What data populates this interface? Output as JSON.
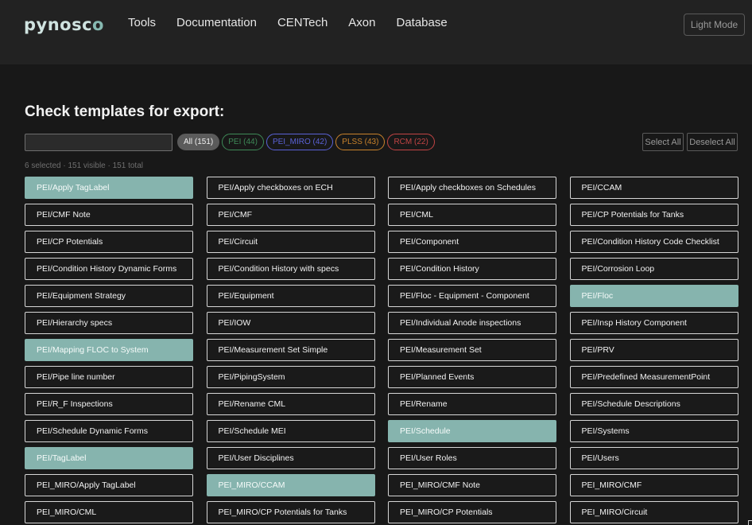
{
  "header": {
    "logo_main": "pynosc",
    "logo_tail": "o",
    "nav": [
      "Tools",
      "Documentation",
      "CENTech",
      "Axon",
      "Database"
    ],
    "light_mode_label": "Light Mode"
  },
  "main": {
    "title": "Check templates for export:",
    "search": {
      "value": "",
      "placeholder": ""
    },
    "filters": [
      {
        "label": "All (151)",
        "color": "#5b5b5b",
        "active": true
      },
      {
        "label": "PEI (44)",
        "color": "#3e8a57"
      },
      {
        "label": "PEI_MIRO (42)",
        "color": "#5a62d6"
      },
      {
        "label": "PLSS (43)",
        "color": "#c9822b"
      },
      {
        "label": "RCM (22)",
        "color": "#c24444"
      }
    ],
    "select_all_label": "Select All",
    "deselect_all_label": "Deselect All",
    "status": "6 selected · 151 visible · 151 total"
  },
  "colors": {
    "selected": "#86b4ae",
    "accent": "#86b9b1"
  },
  "templates": [
    {
      "label": "PEI/Apply TagLabel",
      "selected": true
    },
    {
      "label": "PEI/Apply checkboxes on ECH",
      "selected": false
    },
    {
      "label": "PEI/Apply checkboxes on Schedules",
      "selected": false
    },
    {
      "label": "PEI/CCAM",
      "selected": false
    },
    {
      "label": "PEI/CMF Note",
      "selected": false
    },
    {
      "label": "PEI/CMF",
      "selected": false
    },
    {
      "label": "PEI/CML",
      "selected": false
    },
    {
      "label": "PEI/CP Potentials for Tanks",
      "selected": false
    },
    {
      "label": "PEI/CP Potentials",
      "selected": false
    },
    {
      "label": "PEI/Circuit",
      "selected": false
    },
    {
      "label": "PEI/Component",
      "selected": false
    },
    {
      "label": "PEI/Condition History Code Checklist",
      "selected": false
    },
    {
      "label": "PEI/Condition History Dynamic Forms",
      "selected": false
    },
    {
      "label": "PEI/Condition History with specs",
      "selected": false
    },
    {
      "label": "PEI/Condition History",
      "selected": false
    },
    {
      "label": "PEI/Corrosion Loop",
      "selected": false
    },
    {
      "label": "PEI/Equipment Strategy",
      "selected": false
    },
    {
      "label": "PEI/Equipment",
      "selected": false
    },
    {
      "label": "PEI/Floc - Equipment - Component",
      "selected": false
    },
    {
      "label": "PEI/Floc",
      "selected": true
    },
    {
      "label": "PEI/Hierarchy specs",
      "selected": false
    },
    {
      "label": "PEI/IOW",
      "selected": false
    },
    {
      "label": "PEI/Individual Anode inspections",
      "selected": false
    },
    {
      "label": "PEI/Insp History Component",
      "selected": false
    },
    {
      "label": "PEI/Mapping FLOC to System",
      "selected": true
    },
    {
      "label": "PEI/Measurement Set Simple",
      "selected": false
    },
    {
      "label": "PEI/Measurement Set",
      "selected": false
    },
    {
      "label": "PEI/PRV",
      "selected": false
    },
    {
      "label": "PEI/Pipe line number",
      "selected": false
    },
    {
      "label": "PEI/PipingSystem",
      "selected": false
    },
    {
      "label": "PEI/Planned Events",
      "selected": false
    },
    {
      "label": "PEI/Predefined MeasurementPoint",
      "selected": false
    },
    {
      "label": "PEI/R_F Inspections",
      "selected": false
    },
    {
      "label": "PEI/Rename CML",
      "selected": false
    },
    {
      "label": "PEI/Rename",
      "selected": false
    },
    {
      "label": "PEI/Schedule Descriptions",
      "selected": false
    },
    {
      "label": "PEI/Schedule Dynamic Forms",
      "selected": false
    },
    {
      "label": "PEI/Schedule MEI",
      "selected": false
    },
    {
      "label": "PEI/Schedule",
      "selected": true
    },
    {
      "label": "PEI/Systems",
      "selected": false
    },
    {
      "label": "PEI/TagLabel",
      "selected": true
    },
    {
      "label": "PEI/User Disciplines",
      "selected": false
    },
    {
      "label": "PEI/User Roles",
      "selected": false
    },
    {
      "label": "PEI/Users",
      "selected": false
    },
    {
      "label": "PEI_MIRO/Apply TagLabel",
      "selected": false
    },
    {
      "label": "PEI_MIRO/CCAM",
      "selected": true
    },
    {
      "label": "PEI_MIRO/CMF Note",
      "selected": false
    },
    {
      "label": "PEI_MIRO/CMF",
      "selected": false
    },
    {
      "label": "PEI_MIRO/CML",
      "selected": false
    },
    {
      "label": "PEI_MIRO/CP Potentials for Tanks",
      "selected": false
    },
    {
      "label": "PEI_MIRO/CP Potentials",
      "selected": false
    },
    {
      "label": "PEI_MIRO/Circuit",
      "selected": false
    }
  ]
}
